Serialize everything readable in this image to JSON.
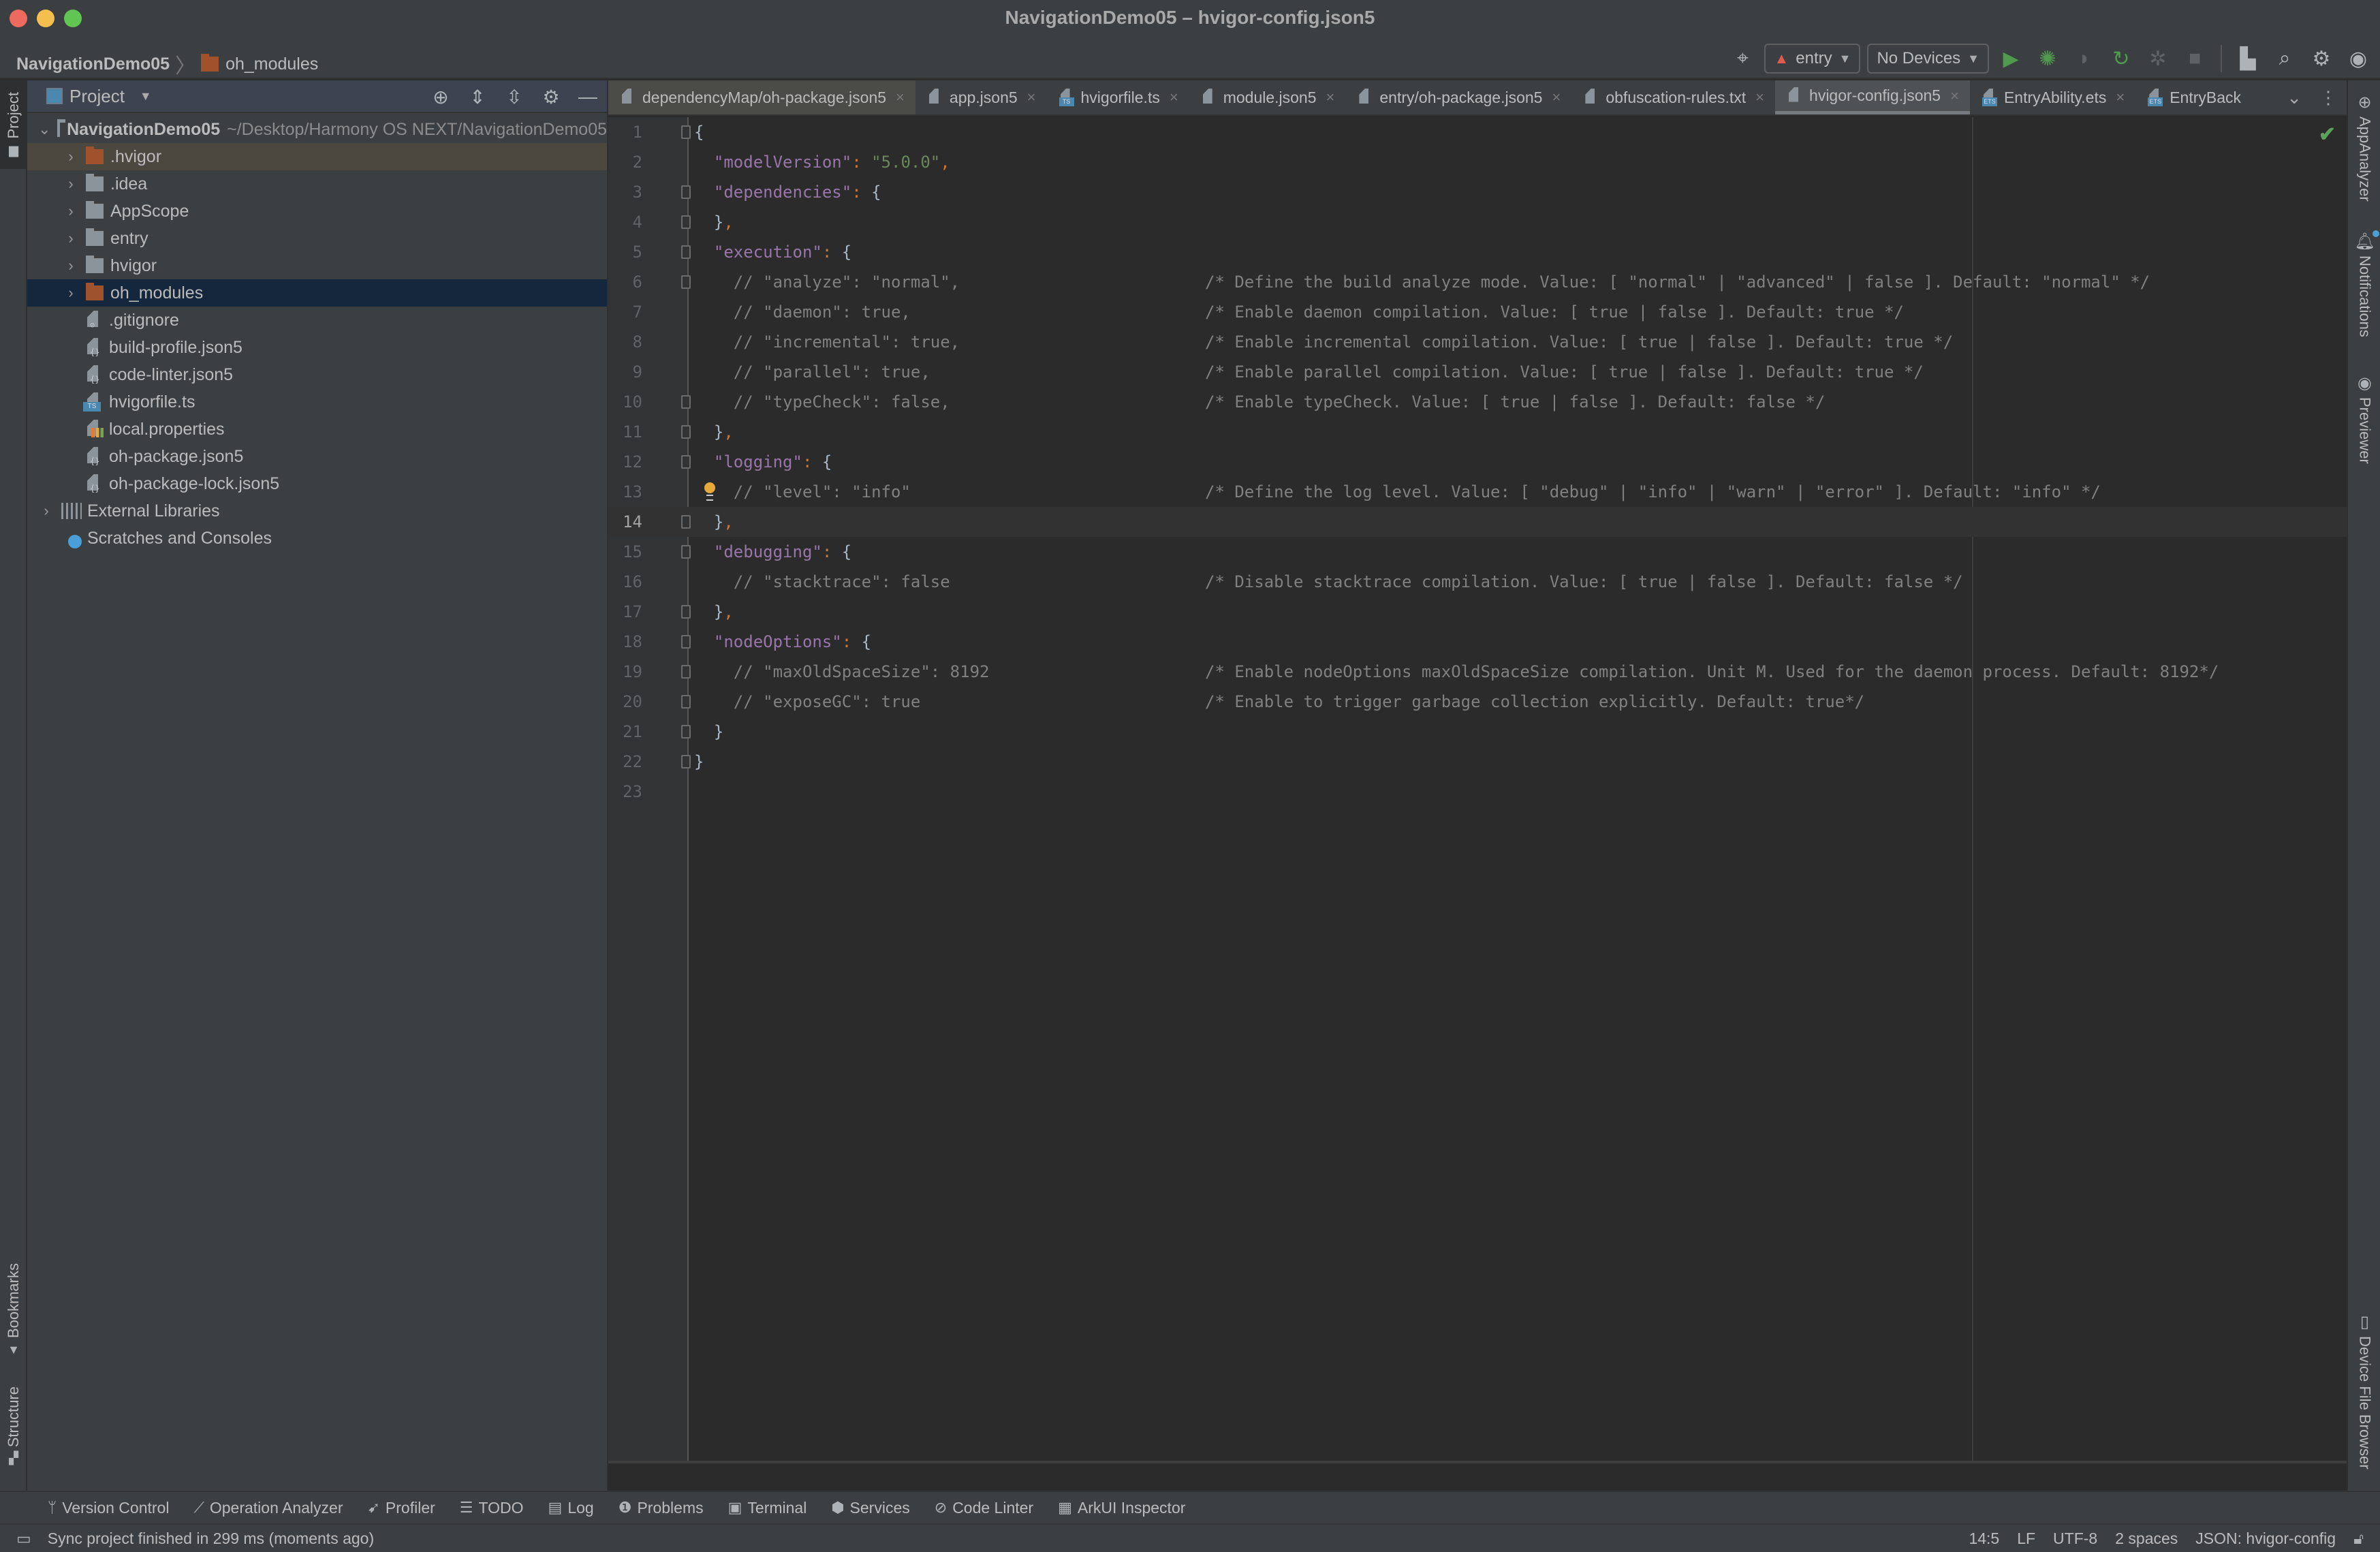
{
  "window": {
    "title": "NavigationDemo05 – hvigor-config.json5"
  },
  "navbar": {
    "breadcrumb": [
      {
        "label": "NavigationDemo05"
      },
      {
        "label": "oh_modules",
        "icon": "folder-icon"
      }
    ],
    "run_config": "entry",
    "device": "No Devices",
    "icons": [
      "target-icon",
      "run-icon",
      "debug-icon",
      "profile-icon",
      "rerun-icon",
      "attach-debugger-icon",
      "stop-icon",
      "project-structure-icon",
      "search-icon",
      "settings-icon",
      "account-icon"
    ]
  },
  "left_stripe": {
    "tabs": [
      {
        "label": "Project",
        "active": true
      },
      {
        "label": "Bookmarks"
      },
      {
        "label": "Structure"
      }
    ]
  },
  "project_panel": {
    "title": "Project",
    "root": {
      "name": "NavigationDemo05",
      "path": "~/Desktop/Harmony OS NEXT/NavigationDemo05"
    },
    "items": [
      {
        "label": ".hvigor",
        "type": "folder-excluded",
        "expandable": true,
        "state": "highlighted"
      },
      {
        "label": ".idea",
        "type": "folder",
        "expandable": true
      },
      {
        "label": "AppScope",
        "type": "folder",
        "expandable": true
      },
      {
        "label": "entry",
        "type": "folder",
        "expandable": true
      },
      {
        "label": "hvigor",
        "type": "folder",
        "expandable": true
      },
      {
        "label": "oh_modules",
        "type": "folder-excluded",
        "expandable": true,
        "state": "selected"
      },
      {
        "label": ".gitignore",
        "type": "gitignore"
      },
      {
        "label": "build-profile.json5",
        "type": "json"
      },
      {
        "label": "code-linter.json5",
        "type": "json"
      },
      {
        "label": "hvigorfile.ts",
        "type": "ts"
      },
      {
        "label": "local.properties",
        "type": "properties"
      },
      {
        "label": "oh-package.json5",
        "type": "json"
      },
      {
        "label": "oh-package-lock.json5",
        "type": "json"
      }
    ],
    "external_libraries": "External Libraries",
    "scratches": "Scratches and Consoles"
  },
  "tabs": [
    {
      "label": "dependencyMap/oh-package.json5",
      "type": "json"
    },
    {
      "label": "app.json5",
      "type": "json"
    },
    {
      "label": "hvigorfile.ts",
      "type": "ts"
    },
    {
      "label": "module.json5",
      "type": "json"
    },
    {
      "label": "entry/oh-package.json5",
      "type": "json"
    },
    {
      "label": "obfuscation-rules.txt",
      "type": "txt"
    },
    {
      "label": "hvigor-config.json5",
      "type": "json",
      "active": true
    },
    {
      "label": "EntryAbility.ets",
      "type": "ets"
    },
    {
      "label": "EntryBack",
      "type": "ets"
    }
  ],
  "editor": {
    "current_line": 14,
    "lines": [
      {
        "n": "1",
        "tokens": [
          [
            "p0",
            "{"
          ]
        ],
        "comment": ""
      },
      {
        "n": "2",
        "tokens": [
          [
            "sp",
            "  "
          ],
          [
            "k",
            "\"modelVersion\""
          ],
          [
            "p",
            ": "
          ],
          [
            "s",
            "\"5.0.0\""
          ],
          [
            "p",
            ","
          ]
        ],
        "comment": ""
      },
      {
        "n": "3",
        "tokens": [
          [
            "sp",
            "  "
          ],
          [
            "k",
            "\"dependencies\""
          ],
          [
            "p",
            ": "
          ],
          [
            "p0",
            "{"
          ]
        ],
        "comment": ""
      },
      {
        "n": "4",
        "tokens": [
          [
            "sp",
            "  "
          ],
          [
            "p0",
            "}"
          ],
          [
            "p",
            ","
          ]
        ],
        "comment": ""
      },
      {
        "n": "5",
        "tokens": [
          [
            "sp",
            "  "
          ],
          [
            "k",
            "\"execution\""
          ],
          [
            "p",
            ": "
          ],
          [
            "p0",
            "{"
          ]
        ],
        "comment": ""
      },
      {
        "n": "6",
        "tokens": [
          [
            "c",
            "    // \"analyze\": \"normal\","
          ]
        ],
        "comment": "/* Define the build analyze mode. Value: [ \"normal\" | \"advanced\" | false ]. Default: \"normal\" */"
      },
      {
        "n": "7",
        "tokens": [
          [
            "c",
            "    // \"daemon\": true,"
          ]
        ],
        "comment": "/* Enable daemon compilation. Value: [ true | false ]. Default: true */"
      },
      {
        "n": "8",
        "tokens": [
          [
            "c",
            "    // \"incremental\": true,"
          ]
        ],
        "comment": "/* Enable incremental compilation. Value: [ true | false ]. Default: true */"
      },
      {
        "n": "9",
        "tokens": [
          [
            "c",
            "    // \"parallel\": true,"
          ]
        ],
        "comment": "/* Enable parallel compilation. Value: [ true | false ]. Default: true */"
      },
      {
        "n": "10",
        "tokens": [
          [
            "c",
            "    // \"typeCheck\": false,"
          ]
        ],
        "comment": "/* Enable typeCheck. Value: [ true | false ]. Default: false */"
      },
      {
        "n": "11",
        "tokens": [
          [
            "sp",
            "  "
          ],
          [
            "p0",
            "}"
          ],
          [
            "p",
            ","
          ]
        ],
        "comment": ""
      },
      {
        "n": "12",
        "tokens": [
          [
            "sp",
            "  "
          ],
          [
            "k",
            "\"logging\""
          ],
          [
            "p",
            ": "
          ],
          [
            "p0",
            "{"
          ]
        ],
        "comment": ""
      },
      {
        "n": "13",
        "tokens": [
          [
            "c",
            "    // \"level\": \"info\""
          ]
        ],
        "comment": "/* Define the log level. Value: [ \"debug\" | \"info\" | \"warn\" | \"error\" ]. Default: \"info\" */"
      },
      {
        "n": "14",
        "tokens": [
          [
            "sp",
            "  "
          ],
          [
            "p0",
            "}"
          ],
          [
            "p",
            ","
          ]
        ],
        "comment": ""
      },
      {
        "n": "15",
        "tokens": [
          [
            "sp",
            "  "
          ],
          [
            "k",
            "\"debugging\""
          ],
          [
            "p",
            ": "
          ],
          [
            "p0",
            "{"
          ]
        ],
        "comment": ""
      },
      {
        "n": "16",
        "tokens": [
          [
            "c",
            "    // \"stacktrace\": false"
          ]
        ],
        "comment": "/* Disable stacktrace compilation. Value: [ true | false ]. Default: false */"
      },
      {
        "n": "17",
        "tokens": [
          [
            "sp",
            "  "
          ],
          [
            "p0",
            "}"
          ],
          [
            "p",
            ","
          ]
        ],
        "comment": ""
      },
      {
        "n": "18",
        "tokens": [
          [
            "sp",
            "  "
          ],
          [
            "k",
            "\"nodeOptions\""
          ],
          [
            "p",
            ": "
          ],
          [
            "p0",
            "{"
          ]
        ],
        "comment": ""
      },
      {
        "n": "19",
        "tokens": [
          [
            "c",
            "    // \"maxOldSpaceSize\": 8192"
          ]
        ],
        "comment": "/* Enable nodeOptions maxOldSpaceSize compilation. Unit M. Used for the daemon process. Default: 8192*/"
      },
      {
        "n": "20",
        "tokens": [
          [
            "c",
            "    // \"exposeGC\": true"
          ]
        ],
        "comment": "/* Enable to trigger garbage collection explicitly. Default: true*/"
      },
      {
        "n": "21",
        "tokens": [
          [
            "sp",
            "  "
          ],
          [
            "p0",
            "}"
          ]
        ],
        "comment": ""
      },
      {
        "n": "22",
        "tokens": [
          [
            "p0",
            "}"
          ]
        ],
        "comment": ""
      },
      {
        "n": "23",
        "tokens": [],
        "comment": ""
      }
    ],
    "fold_lines": [
      1,
      3,
      4,
      5,
      6,
      10,
      11,
      12,
      14,
      15,
      17,
      18,
      19,
      20,
      21,
      22
    ],
    "intention_bulb_line": 13,
    "inspection_status": "no-problems"
  },
  "right_stripe": {
    "tabs": [
      {
        "label": "AppAnalyzer"
      },
      {
        "label": "Notifications",
        "has_badge": true
      },
      {
        "label": "Previewer"
      },
      {
        "label": "Device File Browser"
      }
    ]
  },
  "bottom_bar": {
    "tools": [
      {
        "label": "Version Control",
        "icon": "branch-icon"
      },
      {
        "label": "Operation Analyzer",
        "icon": "chart-icon"
      },
      {
        "label": "Profiler",
        "icon": "profiler-icon"
      },
      {
        "label": "TODO",
        "icon": "list-icon"
      },
      {
        "label": "Log",
        "icon": "log-icon"
      },
      {
        "label": "Problems",
        "icon": "problems-icon"
      },
      {
        "label": "Terminal",
        "icon": "terminal-icon"
      },
      {
        "label": "Services",
        "icon": "services-icon"
      },
      {
        "label": "Code Linter",
        "icon": "code-linter-icon"
      },
      {
        "label": "ArkUI Inspector",
        "icon": "inspector-icon"
      }
    ]
  },
  "status_bar": {
    "message": "Sync project finished in 299 ms (moments ago)",
    "position": "14:5",
    "line_separator": "LF",
    "encoding": "UTF-8",
    "indent": "2 spaces",
    "file_type": "JSON: hvigor-config"
  }
}
